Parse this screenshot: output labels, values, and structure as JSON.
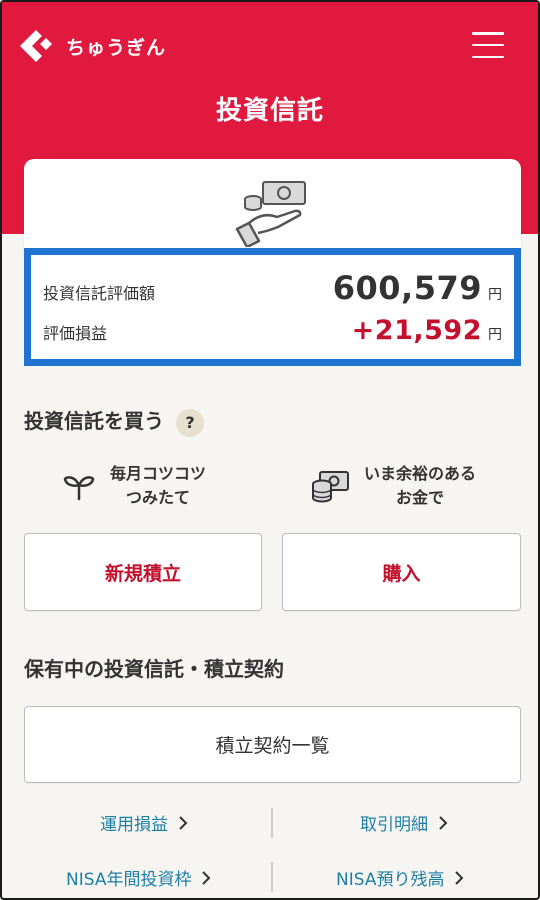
{
  "header": {
    "brand": "ちゅうぎん",
    "title": "投資信託",
    "brand_color": "#e1193f"
  },
  "summary": {
    "valuation_label": "投資信託評価額",
    "valuation_value": "600,579",
    "valuation_unit": "円",
    "pl_label": "評価損益",
    "pl_value": "+21,592",
    "pl_unit": "円",
    "highlight_color": "#1f74cf"
  },
  "buy": {
    "title": "投資信託を買う",
    "help": "?",
    "feature1_line1": "毎月コツコツ",
    "feature1_line2": "つみたて",
    "feature1_icon": "sprout-icon",
    "feature2_line1": "いま余裕のある",
    "feature2_line2": "お金で",
    "feature2_icon": "coins-bill-icon",
    "new_plan_label": "新規積立",
    "purchase_label": "購入"
  },
  "holdings": {
    "title": "保有中の投資信託・積立契約",
    "contract_list_label": "積立契約一覧"
  },
  "links": {
    "pl_link": "運用損益",
    "history_link": "取引明細",
    "nisa_quota_link": "NISA年間投資枠",
    "nisa_balance_link": "NISA預り残高"
  }
}
